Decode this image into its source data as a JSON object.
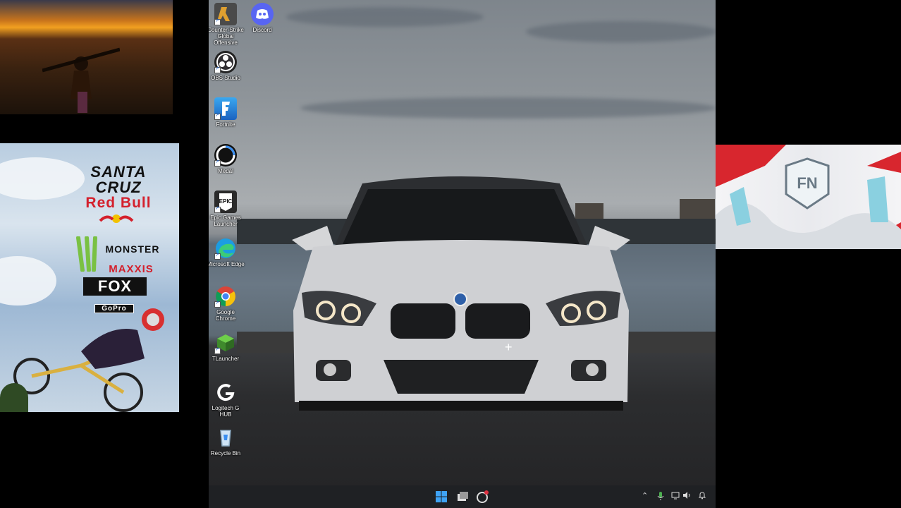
{
  "desktop": {
    "icons": [
      {
        "label": "Counter-Strike Global Offensive",
        "icon": "counter-strike-icon"
      },
      {
        "label": "Discord",
        "icon": "discord-icon"
      },
      {
        "label": "OBS Studio",
        "icon": "obs-icon"
      },
      {
        "label": "Fortnite",
        "icon": "fortnite-icon"
      },
      {
        "label": "Medal",
        "icon": "medal-icon"
      },
      {
        "label": "Epic Games Launcher",
        "icon": "epic-games-icon"
      },
      {
        "label": "Microsoft Edge",
        "icon": "edge-icon"
      },
      {
        "label": "Google Chrome",
        "icon": "chrome-icon"
      },
      {
        "label": "TLauncher",
        "icon": "tlauncher-icon"
      },
      {
        "label": "Logitech G HUB",
        "icon": "logitech-icon"
      },
      {
        "label": "Recycle Bin",
        "icon": "recycle-bin-icon"
      }
    ]
  },
  "sponsors": {
    "line1": "SANTA",
    "line2": "CRUZ",
    "line3": "Red Bull",
    "line4": "MONSTER",
    "line5": "MAXXIS",
    "line6": "FOX",
    "line7": "GoPro"
  },
  "taskbar": {
    "icons": [
      "windows-start-icon",
      "task-view-icon",
      "medal-taskbar-icon"
    ],
    "tray": [
      "chevron-up-icon",
      "microphone-icon",
      "display-icon",
      "volume-icon",
      "notification-bell-icon"
    ]
  },
  "colors": {
    "taskbar": "#1f2124",
    "discord": "#5865f2",
    "redbull": "#d4202c",
    "monster": "#7ac143"
  }
}
